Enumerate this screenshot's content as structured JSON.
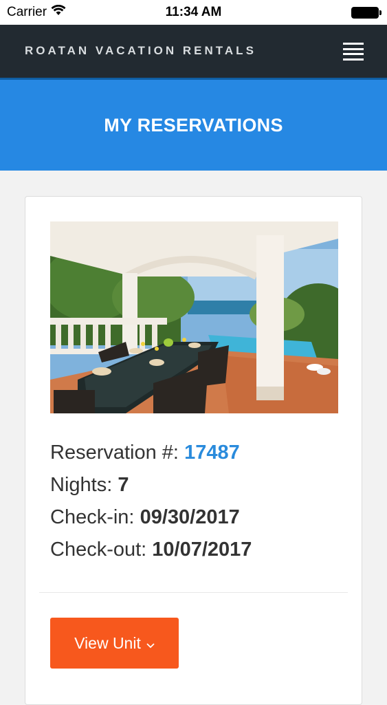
{
  "status_bar": {
    "carrier": "Carrier",
    "time": "11:34 AM",
    "icons": [
      "wifi-icon",
      "battery-icon"
    ]
  },
  "navbar": {
    "brand": "ROATAN VACATION RENTALS",
    "menu_icon": "hamburger-menu-icon"
  },
  "banner": {
    "title": "MY RESERVATIONS"
  },
  "reservation": {
    "photo_alt": "covered patio dining table with pool and ocean view",
    "number_label": "Reservation #:",
    "number": "17487",
    "nights_label": "Nights:",
    "nights": "7",
    "checkin_label": "Check-in:",
    "checkin": "09/30/2017",
    "checkout_label": "Check-out:",
    "checkout": "10/07/2017",
    "view_button": "View Unit",
    "view_button_icon": "chevron-down-icon"
  },
  "colors": {
    "navbar_bg": "#222a31",
    "banner_bg": "#2688e3",
    "accent_link": "#2a8bdc",
    "button_bg": "#f7581d"
  }
}
